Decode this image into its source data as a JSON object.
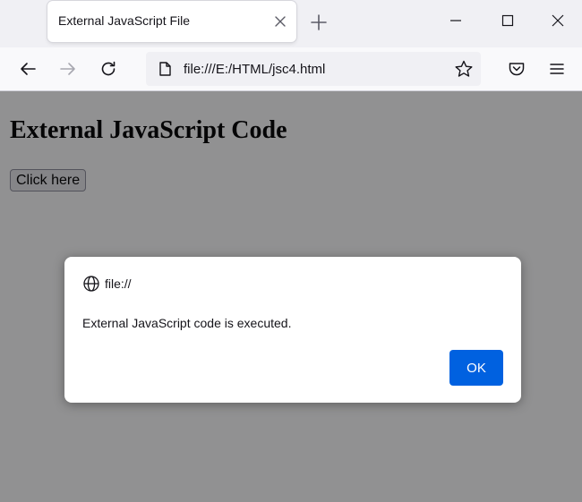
{
  "browser": {
    "tab_title": "External JavaScript File",
    "url": "file:///E:/HTML/jsc4.html",
    "icons": {
      "back": "arrow-left-icon",
      "forward": "arrow-right-icon",
      "reload": "reload-icon",
      "page": "page-icon",
      "bookmark": "star-icon",
      "pocket": "pocket-icon",
      "menu": "hamburger-menu-icon",
      "new_tab": "plus-icon",
      "close_tab": "close-icon"
    }
  },
  "page": {
    "heading": "External JavaScript Code",
    "button_label": "Click here"
  },
  "dialog": {
    "origin": "file://",
    "origin_icon": "globe-icon",
    "message": "External JavaScript code is executed.",
    "ok_label": "OK",
    "accent_color": "#0061e0"
  }
}
